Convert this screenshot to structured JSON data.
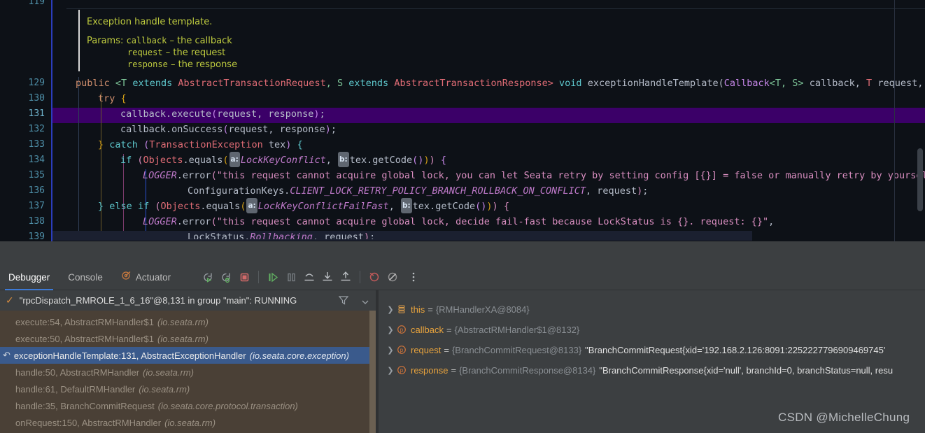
{
  "editor": {
    "javadoc": {
      "title": "Exception handle template.",
      "params_label": "Params:",
      "params": [
        {
          "name": "callback",
          "desc": "– the callback"
        },
        {
          "name": "request",
          "desc": "– the request"
        },
        {
          "name": "response",
          "desc": "– the response"
        }
      ]
    },
    "line_numbers": [
      "119",
      "129",
      "130",
      "131",
      "132",
      "133",
      "134",
      "135",
      "136",
      "137",
      "138",
      "139"
    ],
    "highlighted_line": "131",
    "lines": {
      "l129": "public <T extends AbstractTransactionRequest, S extends AbstractTransactionResponse> void exceptionHandleTemplate(Callback<T, S> callback, T request, S",
      "l130": "try {",
      "l131": "callback.execute(request, response);",
      "l132": "callback.onSuccess(request, response);",
      "l133": "} catch (TransactionException tex) {",
      "l134": "if (Objects.equals( a: LockKeyConflict,  b: tex.getCode())) {",
      "l135": "LOGGER.error(\"this request cannot acquire global lock, you can let Seata retry by setting config [{}] = false or manually retry by yourself.",
      "l136": "ConfigurationKeys.CLIENT_LOCK_RETRY_POLICY_BRANCH_ROLLBACK_ON_CONFLICT, request);",
      "l137": "} else if (Objects.equals( a: LockKeyConflictFailFast,  b: tex.getCode())) {",
      "l138": "LOGGER.error(\"this request cannot acquire global lock, decide fail-fast because LockStatus is {}. request: {}\",",
      "l139": "LockStatus.Rollbacking, request);"
    },
    "hint_a": "a:",
    "hint_b": "b:"
  },
  "panel": {
    "tabs": [
      {
        "label": "Debugger",
        "active": true,
        "icon": null
      },
      {
        "label": "Console",
        "active": false,
        "icon": null
      },
      {
        "label": "Actuator",
        "active": false,
        "icon": "actuator-icon"
      }
    ],
    "toolbar_buttons": [
      {
        "name": "rerun-button",
        "title": "Rerun"
      },
      {
        "name": "rerun-debug-button",
        "title": "Rerun Debug"
      },
      {
        "name": "stop-button",
        "title": "Stop"
      },
      {
        "name": "resume-program-button",
        "title": "Resume Program"
      },
      {
        "name": "pause-program-button",
        "title": "Pause Program"
      },
      {
        "name": "step-over-button",
        "title": "Step Over"
      },
      {
        "name": "step-into-button",
        "title": "Step Into"
      },
      {
        "name": "step-out-button",
        "title": "Step Out"
      },
      {
        "name": "mute-breakpoints-button",
        "title": "Mute Breakpoints"
      },
      {
        "name": "view-breakpoints-button",
        "title": "View Breakpoints"
      },
      {
        "name": "more-options-button",
        "title": "More"
      }
    ]
  },
  "frames": {
    "thread": "\"rpcDispatch_RMROLE_1_6_16\"@8,131 in group \"main\": RUNNING",
    "rows": [
      {
        "method": "execute:54, AbstractRMHandler$1",
        "pkg": "(io.seata.rm)",
        "selected": false
      },
      {
        "method": "execute:50, AbstractRMHandler$1",
        "pkg": "(io.seata.rm)",
        "selected": false
      },
      {
        "method": "exceptionHandleTemplate:131, AbstractExceptionHandler",
        "pkg": "(io.seata.core.exception)",
        "selected": true
      },
      {
        "method": "handle:50, AbstractRMHandler",
        "pkg": "(io.seata.rm)",
        "selected": false
      },
      {
        "method": "handle:61, DefaultRMHandler",
        "pkg": "(io.seata.rm)",
        "selected": false
      },
      {
        "method": "handle:35, BranchCommitRequest",
        "pkg": "(io.seata.core.protocol.transaction)",
        "selected": false
      },
      {
        "method": "onRequest:150, AbstractRMHandler",
        "pkg": "(io.seata.rm)",
        "selected": false
      }
    ]
  },
  "variables": {
    "rows": [
      {
        "icon": "this-object-icon",
        "name": "this",
        "ref": "{RMHandlerXA@8084}",
        "value": ""
      },
      {
        "icon": "parameter-icon",
        "name": "callback",
        "ref": "{AbstractRMHandler$1@8132}",
        "value": ""
      },
      {
        "icon": "parameter-icon",
        "name": "request",
        "ref": "{BranchCommitRequest@8133}",
        "value": "\"BranchCommitRequest{xid='192.168.2.126:8091:2252227796909469745'"
      },
      {
        "icon": "parameter-icon",
        "name": "response",
        "ref": "{BranchCommitResponse@8134}",
        "value": "\"BranchCommitResponse{xid='null', branchId=0, branchStatus=null, resu"
      }
    ]
  },
  "watermark": "CSDN @MichelleChung",
  "colors": {
    "editor_bg": "#0d1117",
    "panel_bg": "#3c3f41",
    "frames_bg": "#4a4036",
    "highlight_line": "#3b0068",
    "selection": "#3a5a8c",
    "accent": "#3d7ad6"
  }
}
